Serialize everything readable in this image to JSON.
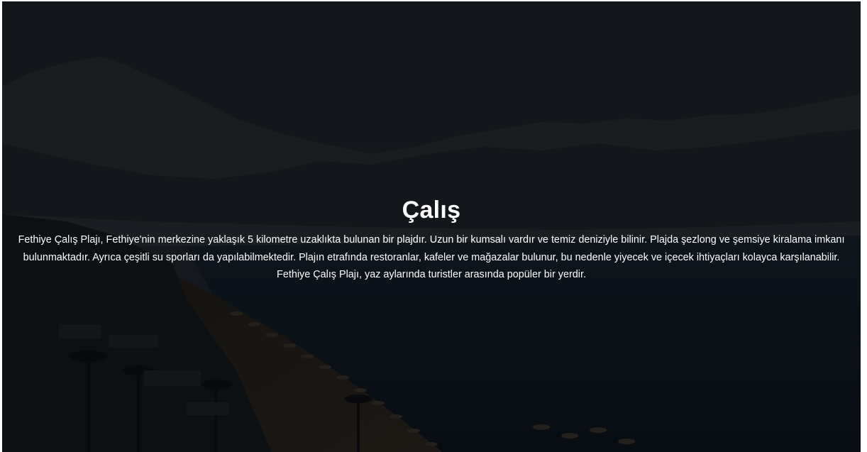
{
  "hero": {
    "title": "Çalış",
    "description": "Fethiye Çalış Plajı, Fethiye'nin merkezine yaklaşık 5 kilometre uzaklıkta bulunan bir plajdır. Uzun bir kumsalı vardır ve temiz deniziyle bilinir. Plajda şezlong ve şemsiye kiralama imkanı bulunmaktadır. Ayrıca çeşitli su sporları da yapılabilmektedir. Plajın etrafında restoranlar, kafeler ve mağazalar bulunur, bu nedenle yiyecek ve içecek ihtiyaçları kolayca karşılanabilir. Fethiye Çalış Plajı, yaz aylarında turistler arasında popüler bir yerdir."
  },
  "colors": {
    "sky": "#1d232b",
    "mountain_far": "#262c33",
    "mountain_near": "#1b2026",
    "sea": "#111d28",
    "beach": "#2a2520",
    "text": "#ffffff"
  }
}
